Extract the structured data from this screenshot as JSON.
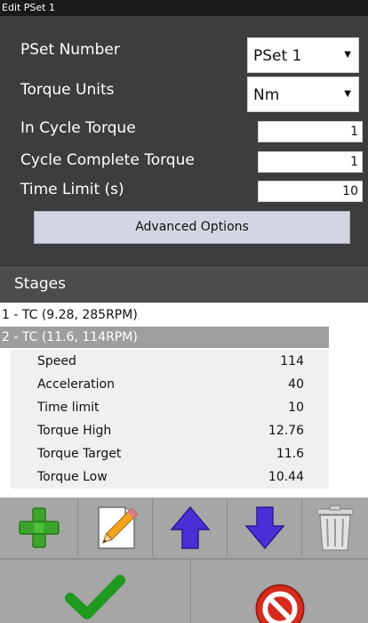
{
  "window": {
    "title": "Edit PSet 1"
  },
  "form": {
    "pset_number": {
      "label": "PSet Number",
      "value": "PSet 1"
    },
    "torque_units": {
      "label": "Torque Units",
      "value": "Nm"
    },
    "in_cycle_torque": {
      "label": "In Cycle Torque",
      "value": "1"
    },
    "cycle_complete_torque": {
      "label": "Cycle Complete Torque",
      "value": "1"
    },
    "time_limit": {
      "label": "Time Limit (s)",
      "value": "10"
    },
    "advanced_label": "Advanced Options"
  },
  "stages": {
    "header": "Stages",
    "items": [
      {
        "label": "1 - TC (9.28, 285RPM)"
      },
      {
        "label": "2 - TC (11.6, 114RPM)",
        "selected": true
      }
    ],
    "params": [
      {
        "name": "Speed",
        "value": "114"
      },
      {
        "name": "Acceleration",
        "value": "40"
      },
      {
        "name": "Time limit",
        "value": "10"
      },
      {
        "name": "Torque High",
        "value": "12.76"
      },
      {
        "name": "Torque Target",
        "value": "11.6"
      },
      {
        "name": "Torque Low",
        "value": "10.44"
      }
    ]
  },
  "toolbar": {
    "icons": [
      "add-icon",
      "edit-icon",
      "move-up-icon",
      "move-down-icon",
      "delete-icon"
    ]
  },
  "actions": {
    "confirm_icon": "check-icon",
    "cancel_icon": "cancel-icon"
  },
  "colors": {
    "panel": "#3d3d3d",
    "selected_stage": "#9e9e9e",
    "toolbar": "#a6a6a6",
    "add_green": "#3aa52a",
    "arrow_blue": "#4a2fd6",
    "confirm_green": "#1f9a1f",
    "cancel_red": "#d62b1f"
  }
}
